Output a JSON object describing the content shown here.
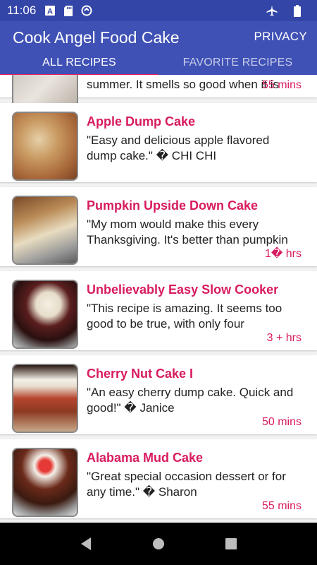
{
  "status_bar": {
    "time": "11:06",
    "icons_left": [
      "font-icon",
      "sd-card-icon",
      "sync-icon"
    ],
    "icons_right": [
      "airplane-icon",
      "battery-icon"
    ]
  },
  "app_bar": {
    "title": "Cook Angel Food Cake",
    "privacy_label": "PRIVACY",
    "color": "#3f51b5"
  },
  "tabs": [
    {
      "label": "ALL RECIPES",
      "active": true
    },
    {
      "label": "FAVORITE RECIPES",
      "active": false
    }
  ],
  "accent_color": "#d81b60",
  "recipes": [
    {
      "title": "",
      "description": "summer. It smells so good when it is",
      "time": "55 mins",
      "partial": true
    },
    {
      "title": "Apple Dump Cake",
      "description": "\"Easy and delicious apple flavored dump cake.\" � CHI CHI",
      "time": ""
    },
    {
      "title": "Pumpkin Upside Down Cake",
      "description": "\"My mom would make this every Thanksgiving. It's better than pumpkin",
      "time": "1� hrs"
    },
    {
      "title": "Unbelievably Easy Slow Cooker",
      "description": "\"This recipe is amazing. It seems too good to be true, with only four",
      "time": "3 + hrs"
    },
    {
      "title": "Cherry Nut Cake I",
      "description": "\"An easy cherry dump cake. Quick and good!\" � Janice",
      "time": "50 mins"
    },
    {
      "title": "Alabama Mud Cake",
      "description": "\"Great special occasion dessert or for any time.\" � Sharon",
      "time": "55 mins"
    }
  ],
  "nav_bar": {
    "buttons": [
      "back-icon",
      "home-icon",
      "recents-icon"
    ]
  }
}
